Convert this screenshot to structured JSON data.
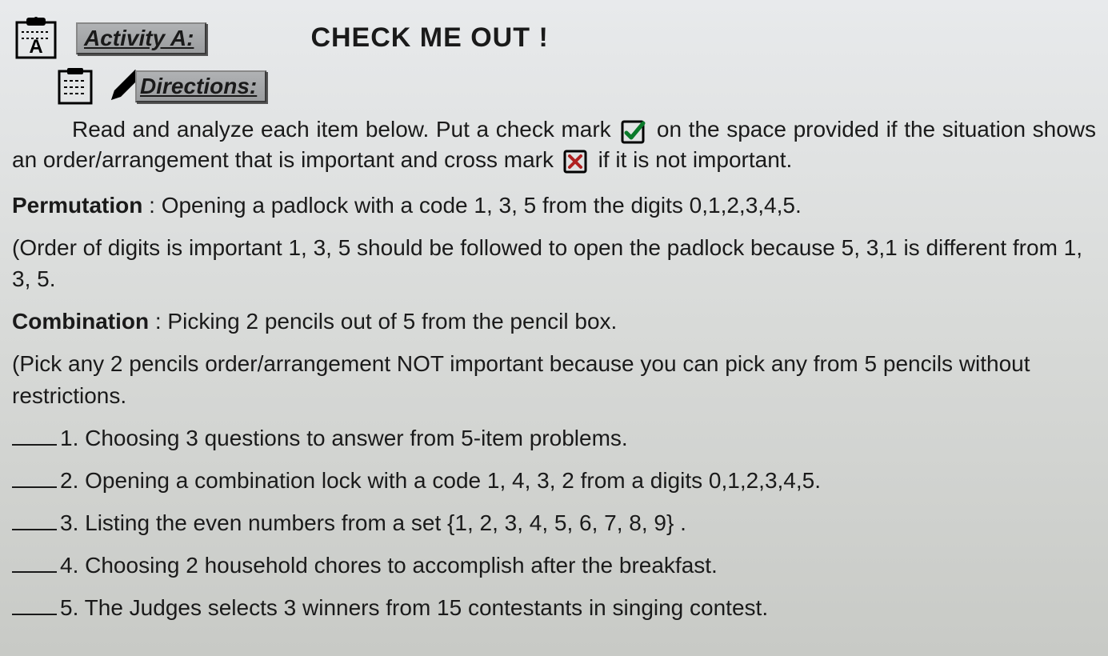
{
  "header": {
    "activityLabel": "Activity A:",
    "title": "CHECK ME OUT !"
  },
  "directions": {
    "label": "Directions:",
    "line1_prefix": "Read and analyze each item below. Put a check mark",
    "line1_suffix": "on the space",
    "line2_prefix": "provided if the situation shows an order/arrangement that is important and cross",
    "line3_prefix": "mark",
    "line3_suffix": "if it is not important."
  },
  "permutation": {
    "label": "Permutation",
    "text": ": Opening a padlock with a code 1, 3, 5 from the digits 0,1,2,3,4,5.",
    "note": "(Order of digits is important 1, 3, 5  should be followed to open the  padlock because 5, 3,1 is different from 1, 3, 5."
  },
  "combination": {
    "label": "Combination",
    "text": ": Picking 2 pencils out of 5 from the pencil box.",
    "note": "(Pick any 2 pencils order/arrangement NOT important because you can pick any from 5 pencils without restrictions."
  },
  "questions": [
    {
      "num": "1.",
      "text": "Choosing 3 questions to answer from 5-item problems."
    },
    {
      "num": "2.",
      "text": "Opening a combination lock with a code 1, 4, 3, 2 from a digits 0,1,2,3,4,5."
    },
    {
      "num": "3.",
      "text": "Listing the even numbers from a set  {1, 2, 3, 4, 5, 6, 7, 8, 9} ."
    },
    {
      "num": "4.",
      "text": "Choosing 2 household chores to accomplish after the breakfast."
    },
    {
      "num": "5.",
      "text": "The Judges selects 3 winners from 15 contestants in singing contest."
    }
  ]
}
